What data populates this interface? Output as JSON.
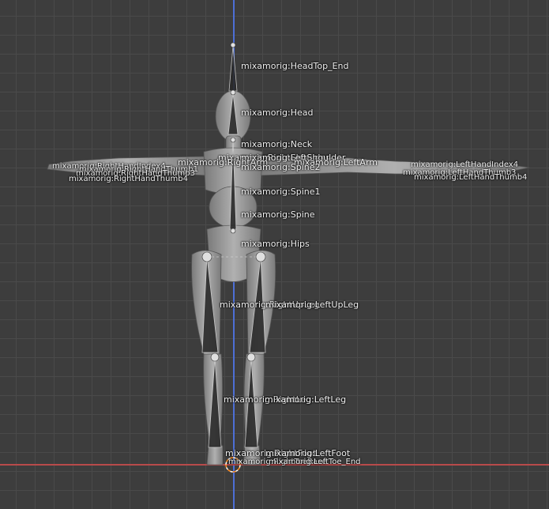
{
  "bones": {
    "head_top_end": "mixamorig:HeadTop_End",
    "head": "mixamorig:Head",
    "neck": "mixamorig:Neck",
    "left_shoulder": "mixamorig:LeftShoulder",
    "right_shoulder": "mixamorig:RightShoulder",
    "left_arm": "mixamorig:LeftArm",
    "right_arm": "mixamorig:RightArm",
    "spine2": "mixamorig:Spine2",
    "spine1": "mixamorig:Spine1",
    "spine": "mixamorig:Spine",
    "hips": "mixamorig:Hips",
    "right_up_leg": "mixamorig:RightUpLeg",
    "left_up_leg": "mixamorig:LeftUpLeg",
    "right_leg": "mixamorig:RightLeg",
    "left_leg": "mixamorig:LeftLeg",
    "right_foot": "mixamorig:RightFoot",
    "left_foot": "mixamorig:LeftFoot",
    "right_toe_base": "mixamorig:RightToeBase",
    "left_toe_base": "mixamorig:LeftToeBase",
    "right_toe_end": "mixamorig:RightToe_End",
    "left_toe_end": "mixamorig:LeftToe_End",
    "right_hand_thumb4": "mixamorig:RightHandThumb4",
    "left_hand_thumb4": "mixamorig:LeftHandThumb4",
    "right_hand_thumb3": "mixamorig:RightHandThumb3",
    "left_hand_thumb3": "mixamorig:LeftHandThumb3",
    "right_hand_thumb1": "mixamorig:RightHandThumb1",
    "left_hand_index4": "mixamorig:LeftHandIndex4",
    "right_hand_index4": "mixamorig:RightHandIndex4"
  },
  "colors": {
    "background": "#3d3d3d",
    "grid": "#4a4a4a",
    "z_axis": "#4d6fd6",
    "x_axis": "#b84a4a",
    "mesh": "#9a9a9a",
    "bone": "#c8c8c8",
    "label": "#f0f0f0",
    "cursor": "#ff8a1e"
  },
  "icons": {
    "cursor": "3d-cursor-icon"
  }
}
